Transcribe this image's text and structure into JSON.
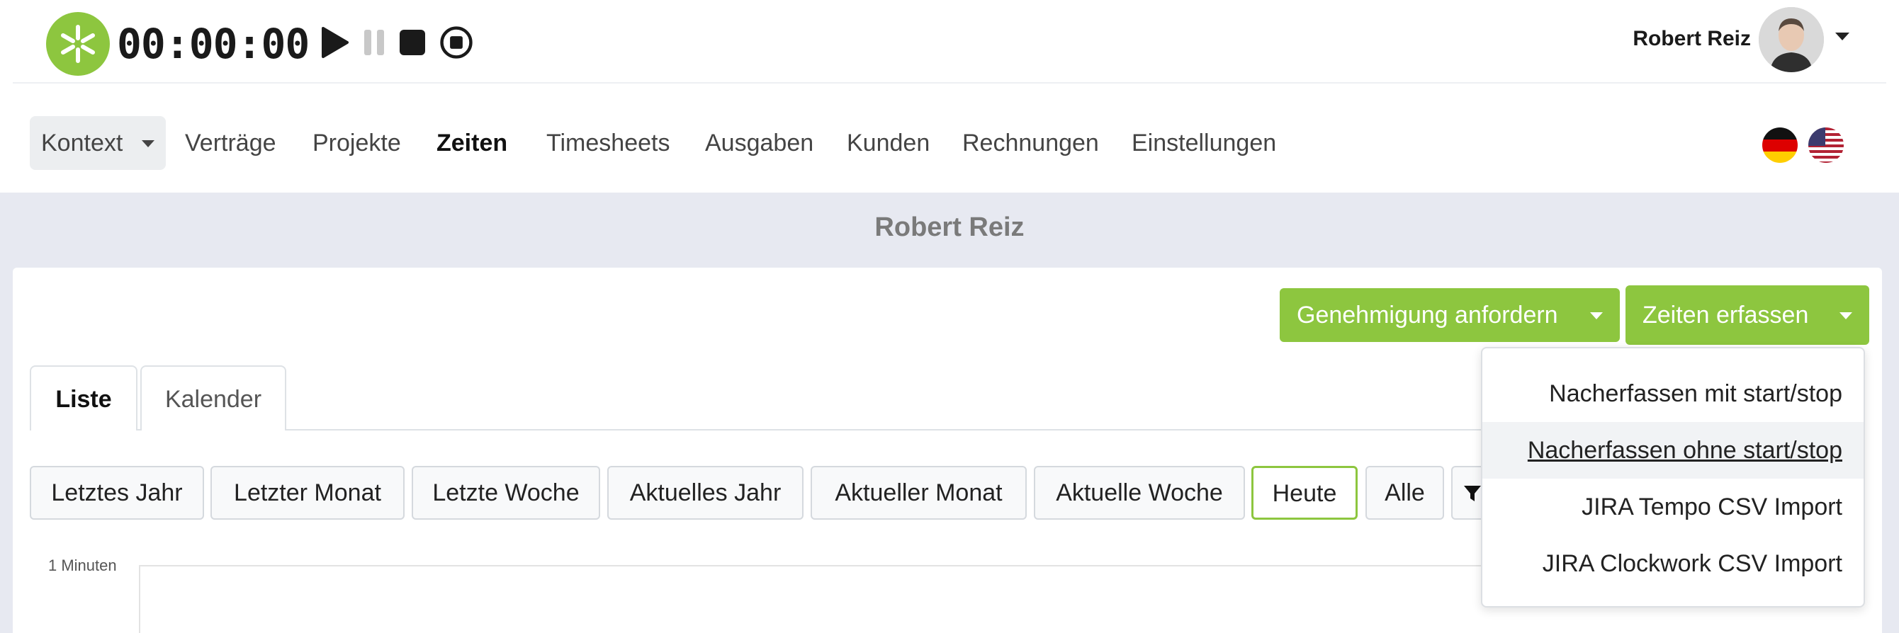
{
  "timer": {
    "display": "00:00:00",
    "controls": [
      "play",
      "pause",
      "stop",
      "record"
    ]
  },
  "user": {
    "name": "Robert Reiz"
  },
  "nav": {
    "items": [
      {
        "label": "Kontext",
        "dropdown": true
      },
      {
        "label": "Verträge"
      },
      {
        "label": "Projekte"
      },
      {
        "label": "Zeiten",
        "active": true
      },
      {
        "label": "Timesheets"
      },
      {
        "label": "Ausgaben"
      },
      {
        "label": "Kunden"
      },
      {
        "label": "Rechnungen"
      },
      {
        "label": "Einstellungen"
      }
    ],
    "languages": [
      "de",
      "en-us"
    ]
  },
  "page": {
    "title": "Robert Reiz"
  },
  "actions": {
    "approval": "Genehmigung anfordern",
    "record_times": "Zeiten erfassen"
  },
  "dropdown": {
    "items": [
      "Nacherfassen mit start/stop",
      "Nacherfassen ohne start/stop",
      "JIRA Tempo CSV Import",
      "JIRA Clockwork CSV Import"
    ],
    "hovered_index": 1
  },
  "tabs": [
    {
      "label": "Liste",
      "active": true
    },
    {
      "label": "Kalender"
    }
  ],
  "filters": {
    "items": [
      "Letztes Jahr",
      "Letzter Monat",
      "Letzte Woche",
      "Aktuelles Jahr",
      "Aktueller Monat",
      "Aktuelle Woche",
      "Heute",
      "Alle"
    ],
    "active": "Heute"
  },
  "chart": {
    "y_label": "1 Minuten"
  },
  "colors": {
    "accent": "#8dc63f",
    "background": "#e7e9f1"
  }
}
